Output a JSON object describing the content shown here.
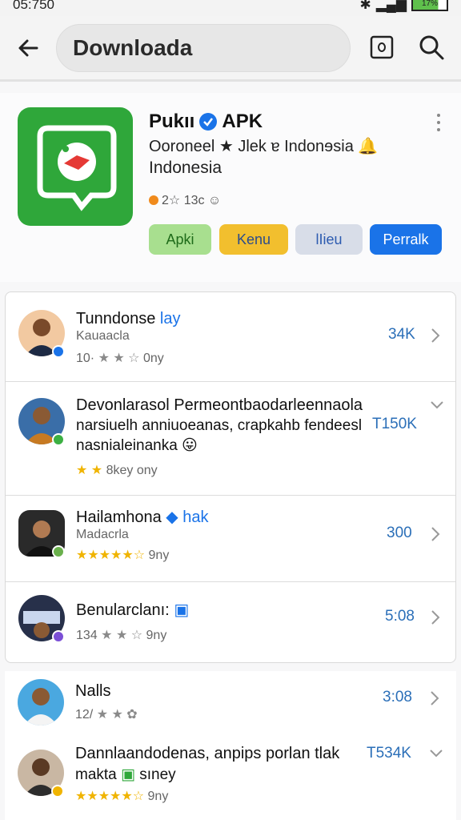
{
  "status_bar": {
    "time": "05:750",
    "battery": "17%"
  },
  "top_bar": {
    "back_label": "Back",
    "search_value": "Downloada",
    "icons": [
      "arrow-left-icon",
      "square-icon",
      "search-icon"
    ]
  },
  "app": {
    "title": "Pukıı",
    "title_suffix": "APK",
    "subtitle": "Ooroneel ★ Jlek ɐ Indonɘsia",
    "subtitle2": "Indonesia",
    "meta": "2☆ 13c ☺",
    "chips": [
      "Apki",
      "Kenu",
      "lIieu",
      "Perralk"
    ],
    "colors": {
      "icon_green": "#2fa73a",
      "accent_blue": "#1a73e8"
    }
  },
  "items": [
    {
      "title": "Tunndonse",
      "title_suffix": "lay",
      "sub": "Kauaacla",
      "rating_text": "10·",
      "stars": "★ ★ ☆",
      "time": "0ny",
      "value": "34K",
      "chevron": "right"
    },
    {
      "title": "Devonlarasol Permeontbaodarleennaola",
      "line2": "narsiuelh anniuoeanas, crapkahb fendeesl",
      "line3": "nasnialeinanka",
      "rating_text": "",
      "stars": "★ ★",
      "time": "8key ony",
      "value": "T150K",
      "chevron": "down"
    },
    {
      "title": "Hailamhona",
      "title_suffix": "hak",
      "sub": "Madacrla",
      "rating_text": "",
      "stars": "★★★★★☆",
      "time": "9ny",
      "value": "300",
      "chevron": "right"
    },
    {
      "title": "Benularclanı:",
      "rating_text": "134",
      "stars": "★ ★ ☆",
      "time": "9ny",
      "value": "5:08",
      "chevron": "right"
    },
    {
      "title": "Nalls",
      "rating_text": "12/",
      "stars": "★ ★ ✿",
      "time": "",
      "value": "3:08",
      "chevron": "right"
    },
    {
      "title": "Dannlaandodenas, anpips porlan tlak",
      "line2": "makta",
      "line2_suffix": "sıney",
      "rating_text": "",
      "stars": "★★★★★☆",
      "time": "9ny",
      "value": "T534K",
      "chevron": "down"
    }
  ]
}
